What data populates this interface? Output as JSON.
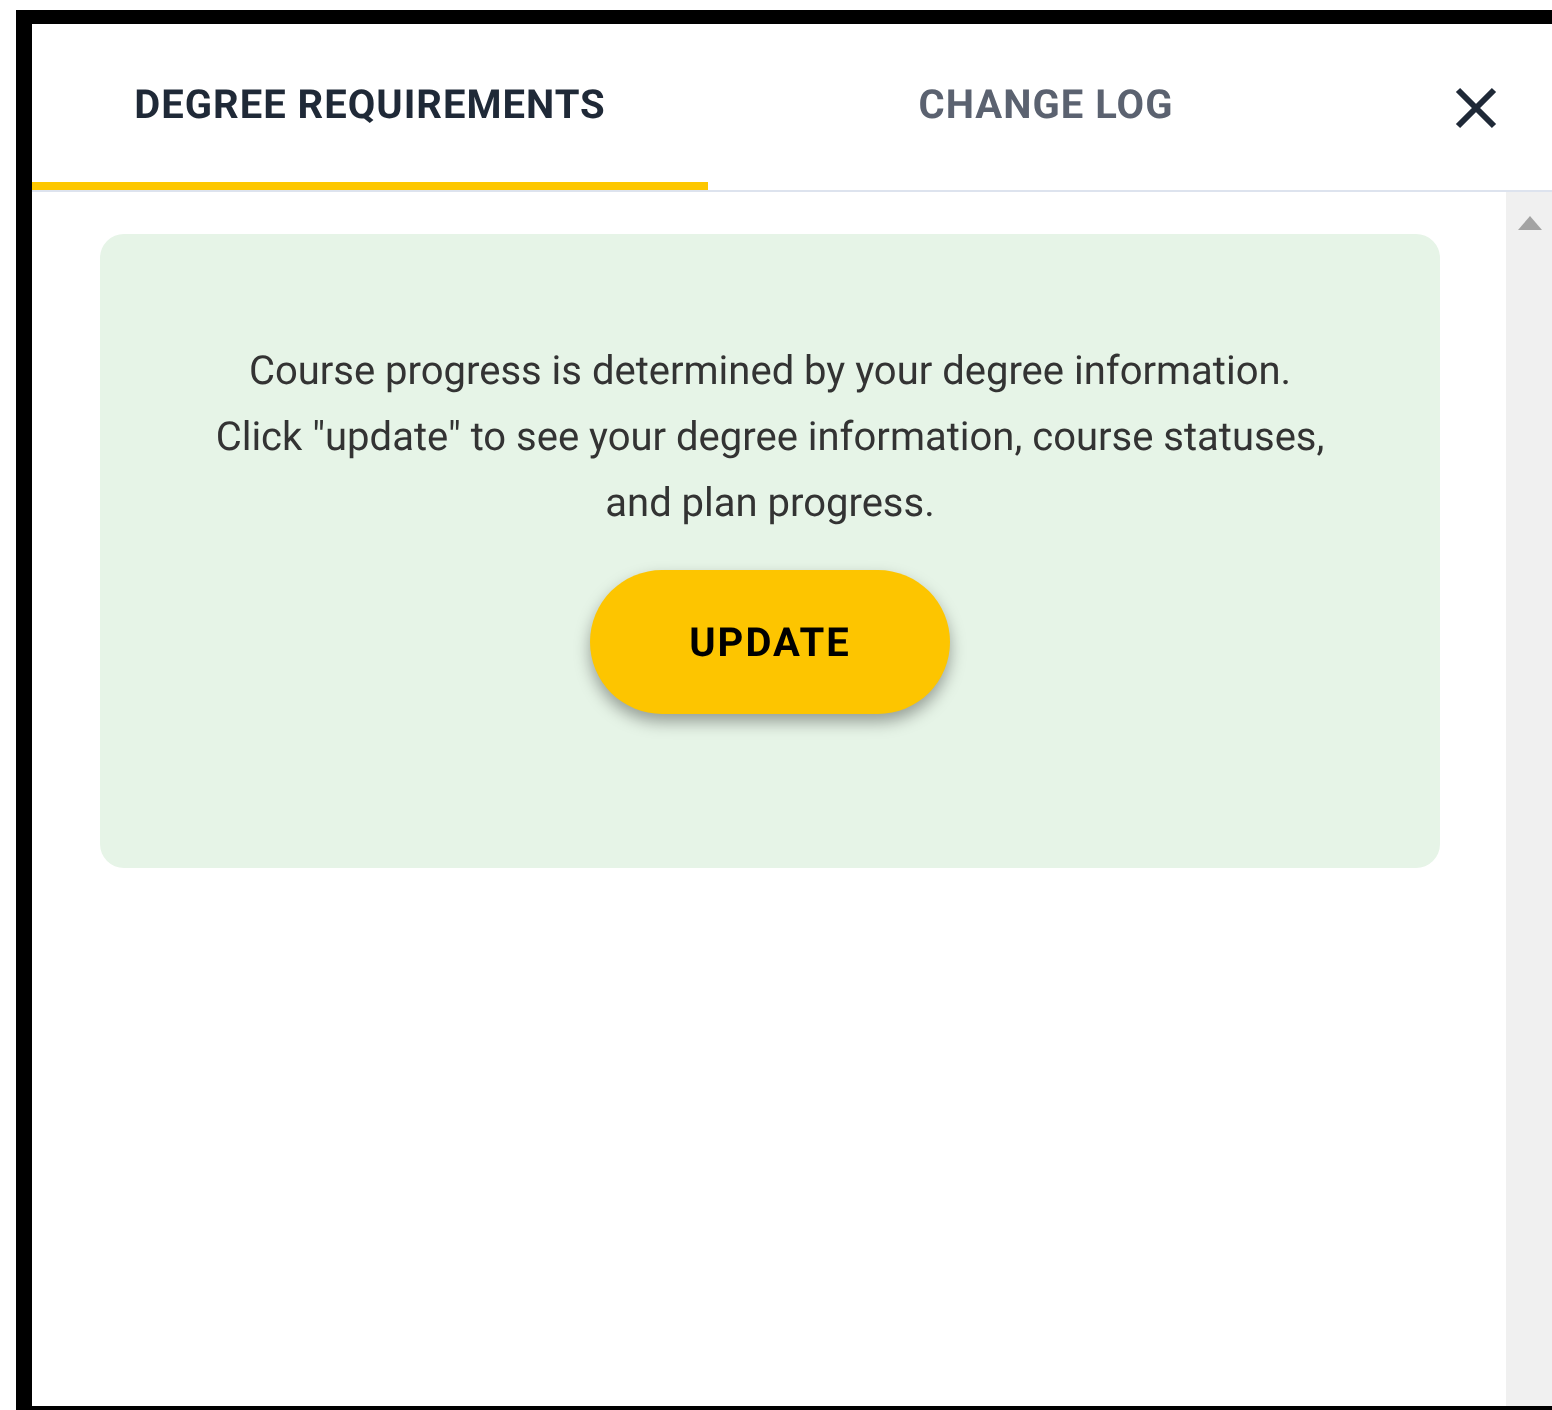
{
  "tabs": [
    {
      "label": "DEGREE REQUIREMENTS",
      "selected": true
    },
    {
      "label": "CHANGE LOG",
      "selected": false
    }
  ],
  "notice": {
    "message": "Course progress is determined by your degree information. Click \"update\" to see your degree information, course statuses, and plan progress.",
    "button": "UPDATE"
  }
}
